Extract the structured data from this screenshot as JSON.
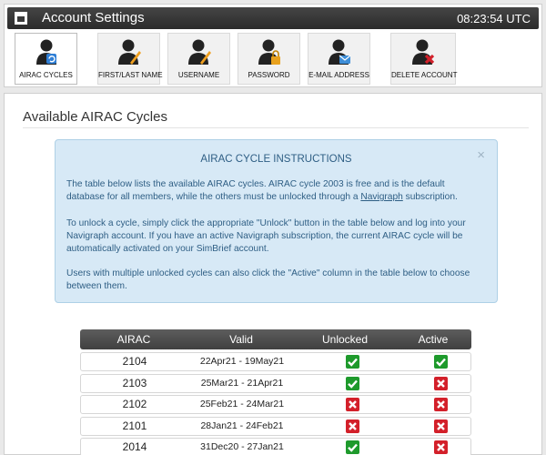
{
  "header": {
    "title": "Account Settings",
    "time": "08:23:54 UTC"
  },
  "tabs": [
    {
      "label": "AIRAC CYCLES",
      "icon": "user-refresh-icon"
    },
    {
      "label": "FIRST/LAST NAME",
      "icon": "user-edit-icon"
    },
    {
      "label": "USERNAME",
      "icon": "user-edit-icon"
    },
    {
      "label": "PASSWORD",
      "icon": "user-lock-icon"
    },
    {
      "label": "E-MAIL ADDRESS",
      "icon": "user-mail-icon"
    },
    {
      "label": "DELETE ACCOUNT",
      "icon": "user-delete-icon"
    }
  ],
  "main": {
    "title": "Available AIRAC Cycles",
    "info": {
      "title": "AIRAC CYCLE INSTRUCTIONS",
      "close": "×",
      "p1_a": "The table below lists the available AIRAC cycles. AIRAC cycle 2003 is free and is the default database for all members, while the others must be unlocked through a ",
      "p1_link": "Navigraph",
      "p1_b": " subscription.",
      "p2": "To unlock a cycle, simply click the appropriate \"Unlock\" button in the table below and log into your Navigraph account. If you have an active Navigraph subscription, the current AIRAC cycle will be automatically activated on your SimBrief account.",
      "p3": "Users with multiple unlocked cycles can also click the \"Active\" column in the table below to choose between them."
    },
    "table": {
      "headers": {
        "airac": "AIRAC",
        "valid": "Valid",
        "unlocked": "Unlocked",
        "active": "Active"
      },
      "rows": [
        {
          "airac": "2104",
          "valid": "22Apr21 - 19May21",
          "unlocked": true,
          "active": true
        },
        {
          "airac": "2103",
          "valid": "25Mar21 - 21Apr21",
          "unlocked": true,
          "active": false
        },
        {
          "airac": "2102",
          "valid": "25Feb21 - 24Mar21",
          "unlocked": false,
          "active": false
        },
        {
          "airac": "2101",
          "valid": "28Jan21 - 24Feb21",
          "unlocked": false,
          "active": false
        },
        {
          "airac": "2014",
          "valid": "31Dec20 - 27Jan21",
          "unlocked": true,
          "active": false
        }
      ]
    }
  },
  "colors": {
    "yes": "#1e9a2c",
    "no": "#d3202a",
    "info_bg": "#d7e9f6"
  }
}
